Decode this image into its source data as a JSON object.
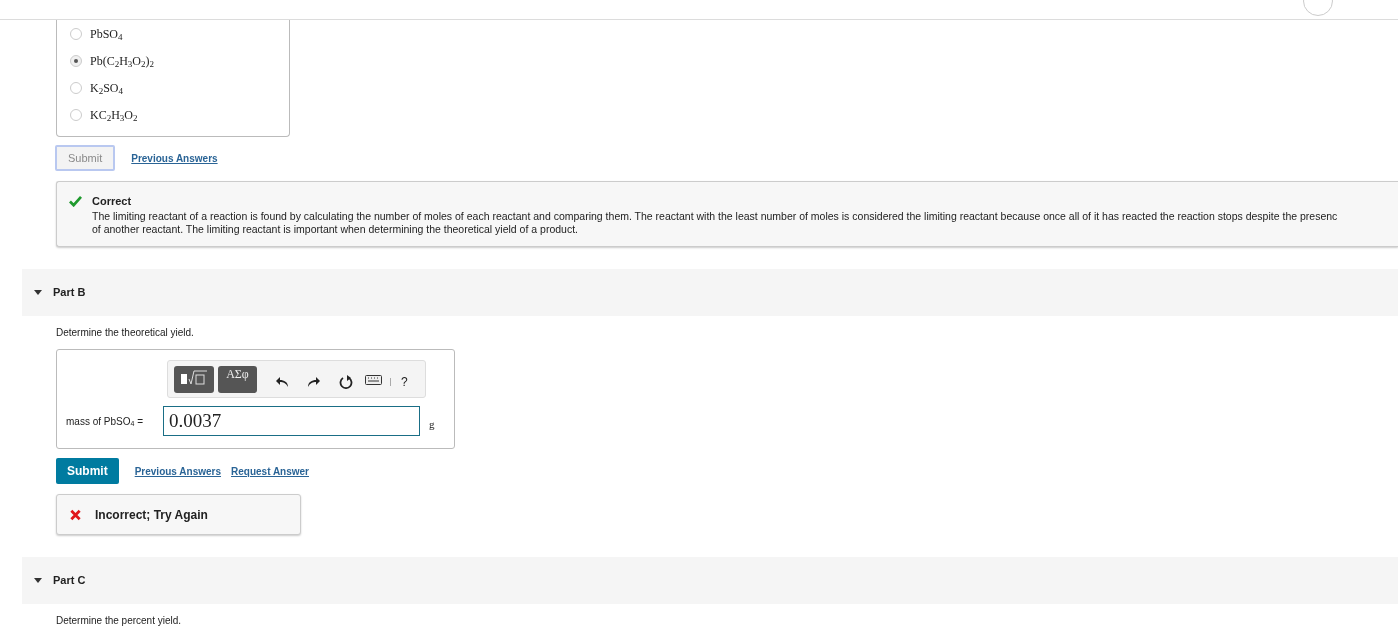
{
  "part_a": {
    "options": [
      {
        "label": "PbSO$_{4}$",
        "selected": false
      },
      {
        "label": "Pb(C$_{2}$H$_{3}$O$_{2}$)$_{2}$",
        "selected": true
      },
      {
        "label": "K$_{2}$SO$_{4}$",
        "selected": false
      },
      {
        "label": "KC$_{2}$H$_{3}$O$_{2}$",
        "selected": false
      }
    ],
    "submit": {
      "label": "Submit",
      "disabled": true
    },
    "links": [
      "Previous Answers"
    ],
    "feedback": {
      "kind": "correct",
      "title": "Correct",
      "lines": [
        "The limiting reactant of a reaction is found by calculating the number of moles of each reactant and comparing them. The reactant with the least number of moles is considered the limiting reactant because once all of it has reacted the reaction stops despite the presenc",
        "of another reactant. The limiting reactant is important when determining the theoretical yield of a product."
      ]
    }
  },
  "part_b": {
    "title": "Part B",
    "expanded": true,
    "prompt": "Determine the theoretical yield.",
    "toolbar": {
      "help": "?",
      "greek": "ΑΣφ"
    },
    "answer": {
      "label": "mass of PbSO$_{4}$ =",
      "value": "0.0037",
      "unit": "g"
    },
    "submit": {
      "label": "Submit",
      "disabled": false
    },
    "links": [
      "Previous Answers",
      "Request Answer"
    ],
    "feedback": {
      "kind": "incorrect",
      "title": "Incorrect; Try Again"
    }
  },
  "part_c": {
    "title": "Part C",
    "expanded": true,
    "prompt": "Determine the percent yield."
  }
}
